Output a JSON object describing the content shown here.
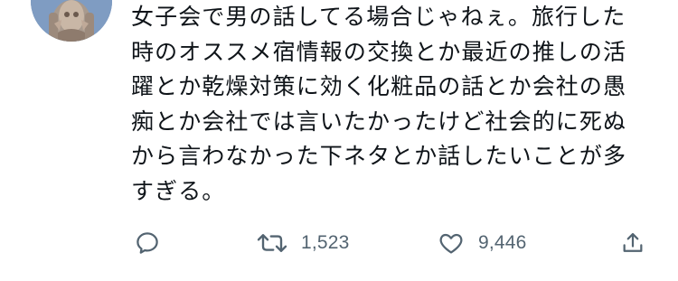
{
  "tweet": {
    "text": "女子会で男の話してる場合じゃねぇ。旅行した\n時のオススメ宿情報の交換とか最近の推しの活\n躍とか乾燥対策に効く化粧品の話とか会社の愚\n痴とか会社では言いたかったけど社会的に死ぬ\nから言わなかった下ネタとか話したいことが多\nすぎる。"
  },
  "actions": {
    "reply": {
      "icon": "reply-icon"
    },
    "retweet": {
      "icon": "retweet-icon",
      "count": "1,523"
    },
    "like": {
      "icon": "heart-icon",
      "count": "9,446"
    },
    "share": {
      "icon": "share-icon"
    }
  },
  "colors": {
    "text": "#0f1419",
    "icon": "#536471",
    "background": "#ffffff"
  }
}
